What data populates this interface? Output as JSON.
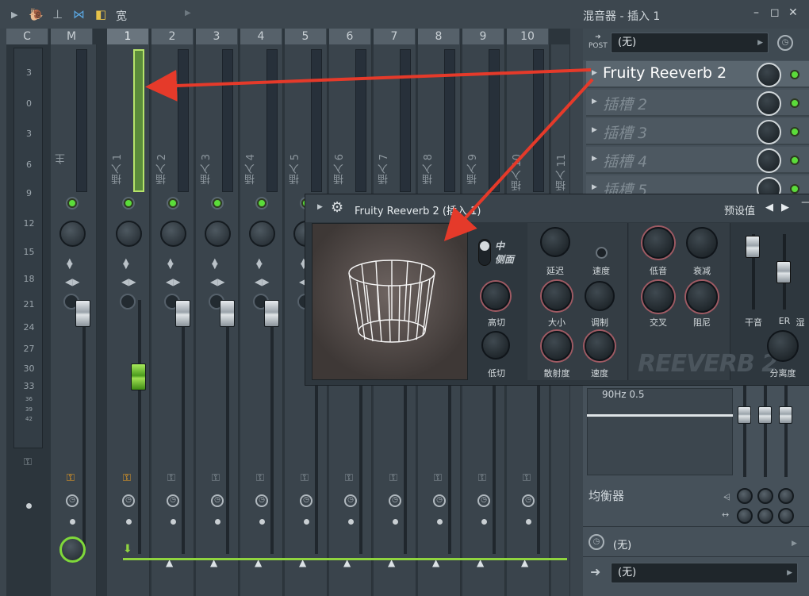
{
  "toolbar": {
    "view_label": "宽",
    "window_title": "混音器 - 插入 1",
    "minimize": "–",
    "maximize": "◻",
    "close": "✕"
  },
  "mixer": {
    "headers": [
      "C",
      "M",
      "1",
      "2",
      "3",
      "4",
      "5",
      "6",
      "7",
      "8",
      "9",
      "10"
    ],
    "scale": [
      "3",
      "0",
      "3",
      "6",
      "9",
      "12",
      "15",
      "18",
      "21",
      "24",
      "27",
      "30",
      "33",
      "36",
      "39",
      "42"
    ],
    "strip_names": [
      "主",
      "插入 1",
      "插入 2",
      "插入 3",
      "插入 4",
      "插入 5",
      "插入 6",
      "插入 7",
      "插入 8",
      "插入 9",
      "插入 10",
      "插入 11"
    ]
  },
  "rpanel": {
    "post_label": "POST",
    "input_value": "(无)",
    "slots": [
      "Fruity Reeverb 2",
      "插槽 2",
      "插槽 3",
      "插槽 4",
      "插槽 5"
    ],
    "eq_label": "均衡器",
    "eq_hz": "90Hz 0.5",
    "bottom_value_1": "(无)",
    "bottom_value_2": "(无)"
  },
  "plugin": {
    "title": "Fruity Reeverb 2 (插入 1)",
    "preset_label": "预设值",
    "prev": "◀",
    "next": "▶",
    "mid": "中",
    "side": "侧面",
    "knobs": {
      "high_cut": "高切",
      "low_cut": "低切",
      "delay": "延迟",
      "speed1": "速度",
      "size": "大小",
      "mod": "调制",
      "diffusion": "散射度",
      "speed2": "速度",
      "bass": "低音",
      "decay": "衰减",
      "crossover": "交叉",
      "damping": "阻尼",
      "dry": "干音",
      "er": "ER",
      "wet": "湿",
      "separation": "分离度"
    },
    "brand": "REEVERB 2"
  },
  "colors": {
    "accent_green": "#5bdc3a",
    "arrow_red": "#e53a2a"
  }
}
